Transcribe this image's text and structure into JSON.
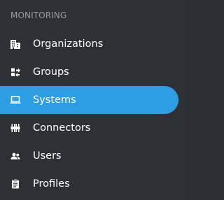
{
  "sidebar": {
    "section_title": "MONITORING",
    "items": [
      {
        "label": "Organizations",
        "icon": "building-icon",
        "active": false
      },
      {
        "label": "Groups",
        "icon": "groups-icon",
        "active": false
      },
      {
        "label": "Systems",
        "icon": "laptop-icon",
        "active": true
      },
      {
        "label": "Connectors",
        "icon": "connectors-icon",
        "active": false
      },
      {
        "label": "Users",
        "icon": "users-icon",
        "active": false
      },
      {
        "label": "Profiles",
        "icon": "clipboard-icon",
        "active": false
      }
    ]
  },
  "colors": {
    "background": "#2e3036",
    "active_background": "#2e9de3",
    "section_title": "#9a9ca2",
    "text": "#ffffff"
  }
}
